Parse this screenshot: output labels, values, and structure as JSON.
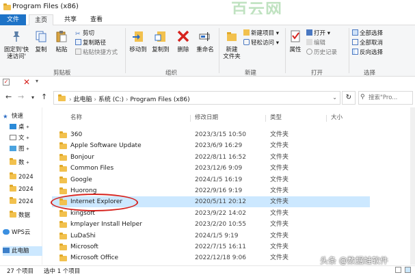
{
  "window": {
    "title": "Program Files (x86)",
    "watermark": "百云网"
  },
  "tabs": [
    "文件",
    "主页",
    "共享",
    "查看"
  ],
  "ribbon": {
    "clipboard": {
      "label": "剪贴板",
      "pin": "固定到'快速访问'",
      "copy": "复制",
      "paste": "粘贴",
      "cut": "剪切",
      "copy_path": "复制路径",
      "paste_shortcut": "粘贴快捷方式"
    },
    "organize": {
      "label": "组织",
      "move_to": "移动到",
      "copy_to": "复制到",
      "delete": "删除",
      "rename": "重命名"
    },
    "new": {
      "label": "新建",
      "new_folder": "新建\n文件夹",
      "new_item": "新建项目 ▾",
      "easy_access": "轻松访问 ▾"
    },
    "open": {
      "label": "打开",
      "properties": "属性",
      "open": "打开 ▾",
      "edit": "编辑",
      "history": "历史记录"
    },
    "select": {
      "label": "选择",
      "select_all": "全部选择",
      "select_none": "全部取消",
      "invert": "反向选择"
    }
  },
  "address": {
    "crumbs": [
      "此电脑",
      "系统 (C:)",
      "Program Files (x86)"
    ],
    "search_placeholder": "搜索\"Pro..."
  },
  "navpane": [
    "快速",
    "桌",
    "文",
    "图",
    "数",
    "2024",
    "2024",
    "2024",
    "数据",
    "WPS云",
    "此电脑"
  ],
  "columns": {
    "name": "名称",
    "date": "修改日期",
    "type": "类型",
    "size": "大小"
  },
  "files": [
    {
      "name": "360",
      "date": "2023/3/15 10:50",
      "type": "文件夹"
    },
    {
      "name": "Apple Software Update",
      "date": "2023/6/9 16:29",
      "type": "文件夹"
    },
    {
      "name": "Bonjour",
      "date": "2022/8/11 16:52",
      "type": "文件夹"
    },
    {
      "name": "Common Files",
      "date": "2023/12/6 9:09",
      "type": "文件夹"
    },
    {
      "name": "Google",
      "date": "2024/1/5 16:19",
      "type": "文件夹"
    },
    {
      "name": "Huorong",
      "date": "2022/9/16 9:19",
      "type": "文件夹"
    },
    {
      "name": "Internet Explorer",
      "date": "2020/5/11 20:12",
      "type": "文件夹"
    },
    {
      "name": "kingsoft",
      "date": "2023/9/22 14:02",
      "type": "文件夹"
    },
    {
      "name": "kmplayer Install Helper",
      "date": "2023/2/20 10:55",
      "type": "文件夹"
    },
    {
      "name": "LuDaShi",
      "date": "2024/1/5 9:19",
      "type": "文件夹"
    },
    {
      "name": "Microsoft",
      "date": "2022/7/15 16:11",
      "type": "文件夹"
    },
    {
      "name": "Microsoft Office",
      "date": "2022/12/18 9:06",
      "type": "文件夹"
    }
  ],
  "status": {
    "count": "27 个项目",
    "selected": "选中 1 个项目"
  },
  "watermark_bottom": "头条 @数据蛙软件"
}
